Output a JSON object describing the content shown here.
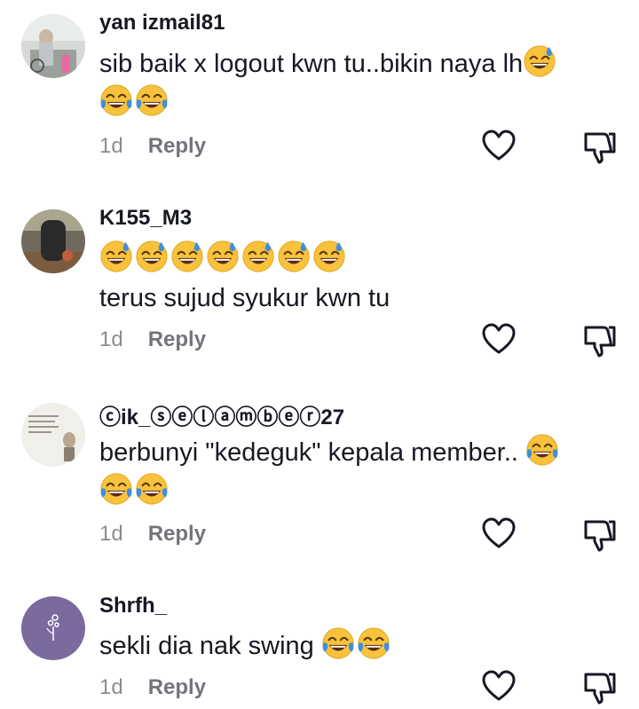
{
  "comments": [
    {
      "username": "yan izmail81",
      "text": "sib baik x logout kwn tu..bikin naya lh",
      "time": "1d",
      "reply_label": "Reply",
      "avatar_icon": "photo-avatar-icon",
      "emojis_after_text": [
        "sweat-smile",
        "joy",
        "joy"
      ]
    },
    {
      "username": "K155_M3",
      "text": "terus sujud syukur kwn tu",
      "time": "1d",
      "reply_label": "Reply",
      "avatar_icon": "photo-avatar-icon",
      "emojis_before_text": [
        "sweat-smile",
        "sweat-smile",
        "sweat-smile",
        "sweat-smile",
        "sweat-smile",
        "sweat-smile",
        "sweat-smile"
      ]
    },
    {
      "username": "ⓒik_ⓢⓔⓛⓐⓜⓑⓔⓡ27",
      "text": "berbunyi \"kedeguk\" kepala member..",
      "time": "1d",
      "reply_label": "Reply",
      "avatar_icon": "photo-avatar-icon",
      "emojis_after_text": [
        "joy",
        "joy",
        "joy"
      ]
    },
    {
      "username": "Shrfh_",
      "text": "sekli dia nak swing",
      "time": "1d",
      "reply_label": "Reply",
      "avatar_icon": "flower-avatar-icon",
      "emojis_after_text": [
        "joy",
        "joy"
      ]
    }
  ],
  "colors": {
    "text_primary": "#161823",
    "text_secondary": "#8a8b91",
    "avatar_purple": "#7b6a9e",
    "emoji_yellow": "#f9c23c",
    "tear_blue": "#3d8fe0"
  }
}
